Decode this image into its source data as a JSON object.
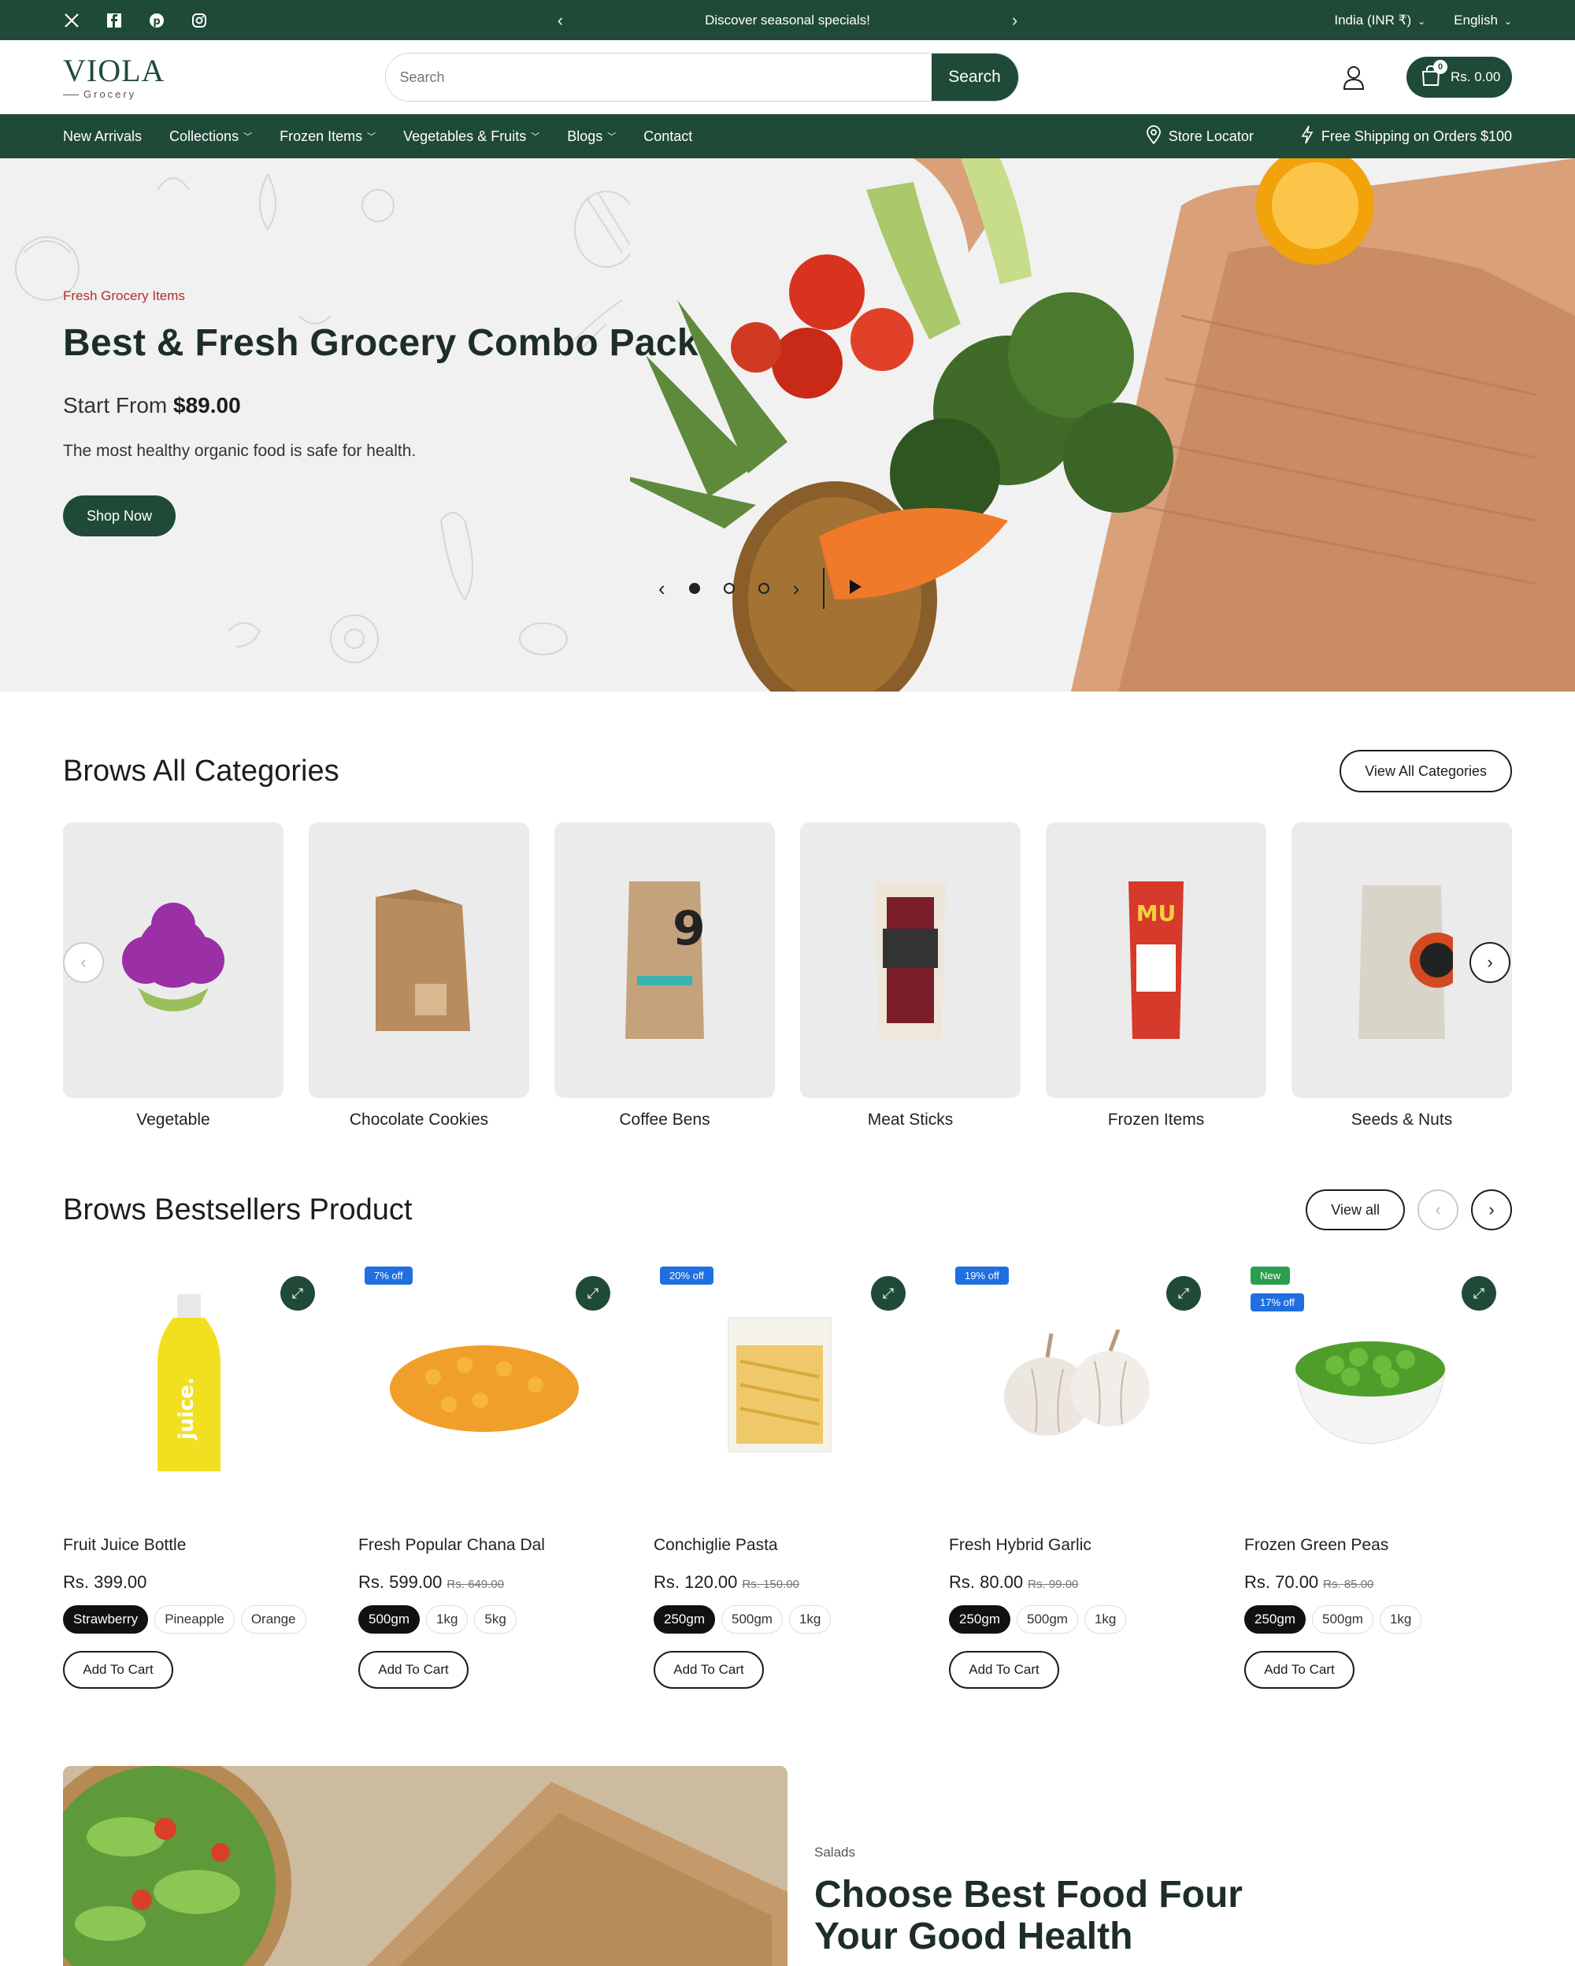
{
  "topbar": {
    "announcement": "Discover seasonal specials!",
    "region": "India (INR ₹)",
    "language": "English",
    "socials": [
      "x-icon",
      "facebook-icon",
      "pinterest-icon",
      "instagram-icon"
    ]
  },
  "header": {
    "logo_main": "VIOLA",
    "logo_sub": "Grocery",
    "search_placeholder": "Search",
    "search_button": "Search",
    "cart_count": "0",
    "cart_total": "Rs. 0.00"
  },
  "nav": {
    "items": [
      "New Arrivals",
      "Collections",
      "Frozen Items",
      "Vegetables & Fruits",
      "Blogs",
      "Contact"
    ],
    "store_locator": "Store Locator",
    "shipping": "Free Shipping on Orders $100"
  },
  "hero": {
    "eyebrow": "Fresh Grocery Items",
    "title": "Best & Fresh Grocery Combo Pack",
    "price_prefix": "Start From",
    "price": "$89.00",
    "description": "The most healthy organic food is safe for health.",
    "cta": "Shop Now",
    "slides": 3,
    "active_slide": 1
  },
  "categories": {
    "title": "Brows All Categories",
    "view_all": "View All Categories",
    "items": [
      "Vegetable",
      "Chocolate Cookies",
      "Coffee Bens",
      "Meat Sticks",
      "Frozen Items",
      "Seeds & Nuts"
    ]
  },
  "bestsellers": {
    "title": "Brows Bestsellers Product",
    "view_all": "View all",
    "add_to_cart": "Add To Cart",
    "products": [
      {
        "name": "Fruit Juice Bottle",
        "price": "Rs. 399.00",
        "compare": "",
        "badges": [],
        "variants": [
          "Strawberry",
          "Pineapple",
          "Orange"
        ]
      },
      {
        "name": "Fresh Popular Chana Dal",
        "price": "Rs. 599.00",
        "compare": "Rs. 649.00",
        "badges": [
          "7% off"
        ],
        "variants": [
          "500gm",
          "1kg",
          "5kg"
        ]
      },
      {
        "name": "Conchiglie Pasta",
        "price": "Rs. 120.00",
        "compare": "Rs. 150.00",
        "badges": [
          "20% off"
        ],
        "variants": [
          "250gm",
          "500gm",
          "1kg"
        ]
      },
      {
        "name": "Fresh Hybrid Garlic",
        "price": "Rs. 80.00",
        "compare": "Rs. 99.00",
        "badges": [
          "19% off"
        ],
        "variants": [
          "250gm",
          "500gm",
          "1kg"
        ]
      },
      {
        "name": "Frozen Green Peas",
        "price": "Rs. 70.00",
        "compare": "Rs. 85.00",
        "badges": [
          "New",
          "17% off"
        ],
        "variants": [
          "250gm",
          "500gm",
          "1kg"
        ]
      }
    ]
  },
  "promo": {
    "eyebrow": "Salads",
    "title": "Choose Best Food Four Your Good Health"
  },
  "colors": {
    "brand": "#1f4a38",
    "accent_red": "#b52d2d",
    "badge_blue": "#1f6fe0",
    "badge_green": "#2b9e4e"
  }
}
